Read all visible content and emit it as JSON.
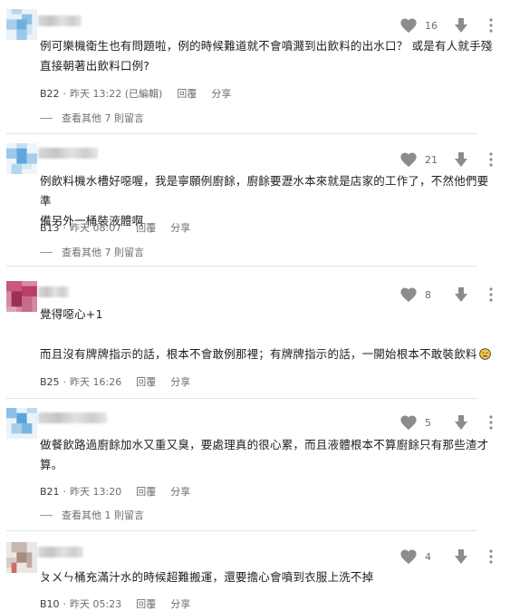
{
  "comments": [
    {
      "likes": "16",
      "text": "例可樂機衛生也有問題啦，例的時候難道就不會噴濺到出飲料的出水口？ 或是有人就手殘\n直接朝著出飲料口例?",
      "floor": "B22",
      "time": "昨天 13:22 (已編輯)",
      "reply_label": "回覆",
      "share_label": "分享",
      "more_replies": "查看其他 7 則留言"
    },
    {
      "likes": "21",
      "text": "例飲料機水槽好噁喔，我是寧願例廚餘，廚餘要瀝水本來就是店家的工作了，不然他們要準\n備另外一桶裝液體啊",
      "floor": "B13",
      "time": "昨天 08:07",
      "reply_label": "回覆",
      "share_label": "分享",
      "more_replies": "查看其他 7 則留言"
    },
    {
      "likes": "8",
      "text": "覺得噁心+1\n\n而且沒有牌牌指示的話，根本不會敢例那裡；有牌牌指示的話，一開始根本不敢裝飲料",
      "emoji": "sad-face",
      "floor": "B25",
      "time": "昨天 16:26",
      "reply_label": "回覆",
      "share_label": "分享"
    },
    {
      "likes": "5",
      "text": "做餐飲路過廚餘加水又重又臭，要處理真的很心累，而且液體根本不算廚餘只有那些渣才\n算。",
      "floor": "B21",
      "time": "昨天 13:20",
      "reply_label": "回覆",
      "share_label": "分享",
      "more_replies": "查看其他 1 則留言"
    },
    {
      "likes": "4",
      "text": "ㄆㄨㄣ桶充滿汁水的時候超難搬運，還要擔心會噴到衣服上洗不掉",
      "floor": "B10",
      "time": "昨天 05:23",
      "reply_label": "回覆",
      "share_label": "分享"
    }
  ],
  "colors": {
    "icon": "#8c8c8c",
    "meta_text": "#6e6e6e",
    "body_text": "#1f1f1f",
    "divider": "#e3e3e3",
    "avatar_blue": "#7fb6e0",
    "avatar_pink": "#c2567a",
    "avatar_gray": "#b9a6a0"
  }
}
